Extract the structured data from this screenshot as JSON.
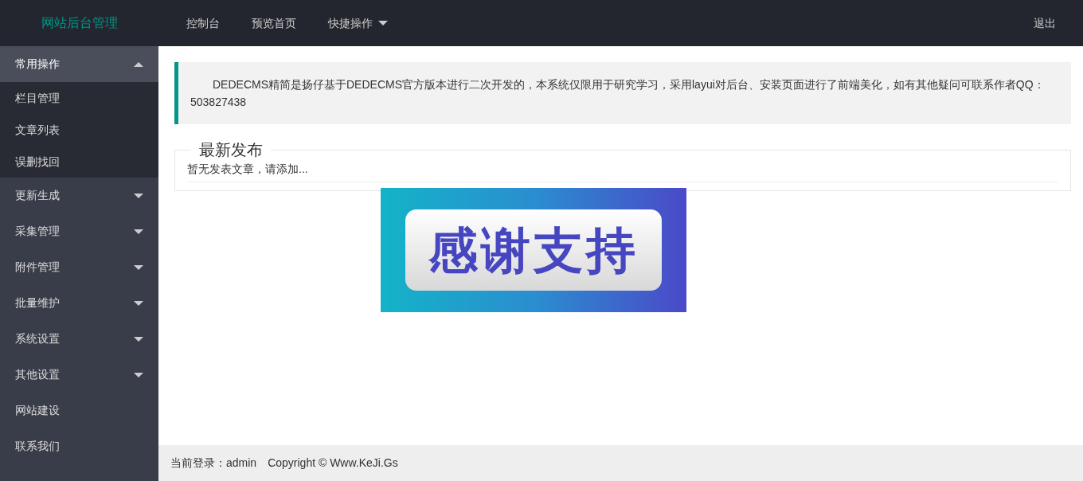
{
  "header": {
    "logo": "网站后台管理",
    "nav": [
      {
        "label": "控制台",
        "dropdown": false
      },
      {
        "label": "预览首页",
        "dropdown": false
      },
      {
        "label": "快捷操作",
        "dropdown": true
      }
    ],
    "logout": "退出"
  },
  "sidebar": {
    "items": [
      {
        "kind": "group",
        "label": "常用操作",
        "expanded": true,
        "children": [
          {
            "label": "栏目管理"
          },
          {
            "label": "文章列表"
          },
          {
            "label": "误删找回"
          }
        ]
      },
      {
        "kind": "group",
        "label": "更新生成",
        "expanded": false
      },
      {
        "kind": "group",
        "label": "采集管理",
        "expanded": false
      },
      {
        "kind": "group",
        "label": "附件管理",
        "expanded": false
      },
      {
        "kind": "group",
        "label": "批量维护",
        "expanded": false
      },
      {
        "kind": "group",
        "label": "系统设置",
        "expanded": false
      },
      {
        "kind": "group",
        "label": "其他设置",
        "expanded": false
      },
      {
        "kind": "link",
        "label": "网站建设"
      },
      {
        "kind": "link",
        "label": "联系我们"
      }
    ]
  },
  "notice": "DEDECMS精简是扬仔基于DEDECMS官方版本进行二次开发的，本系统仅限用于研究学习，采用layui对后台、安装页面进行了前端美化，如有其他疑问可联系作者QQ：503827438",
  "latest": {
    "legend": "最新发布",
    "empty_text": "暂无发表文章，请添加..."
  },
  "banner": {
    "text": "感谢支持"
  },
  "footer": {
    "login_label": "当前登录：",
    "user": "admin",
    "copyright": "Copyright © Www.KeJi.Gs"
  }
}
